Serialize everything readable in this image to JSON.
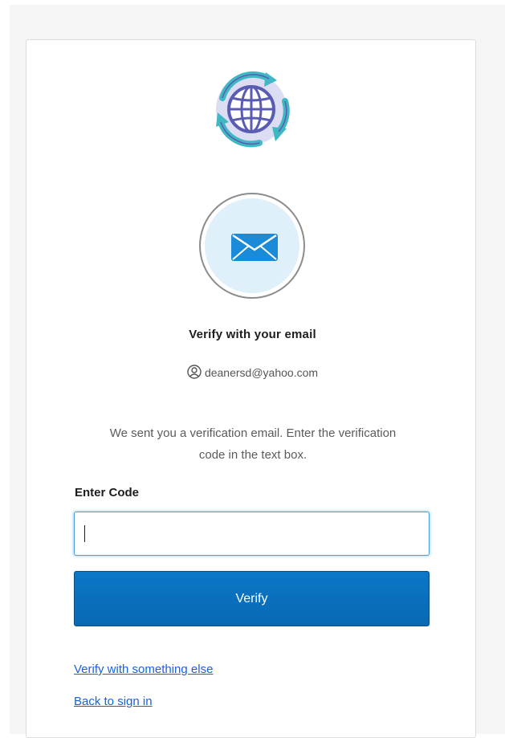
{
  "logo": {
    "icon": "globe-refresh-icon"
  },
  "auth_icon": {
    "icon": "email-envelope-icon"
  },
  "title": "Verify with your email",
  "identifier": {
    "icon": "user-circle-icon",
    "email": "deanersd@yahoo.com"
  },
  "instructions": "We sent you a verification email. Enter the verification code in the text box.",
  "code_field": {
    "label": "Enter Code",
    "value": "",
    "placeholder": ""
  },
  "verify_button": {
    "label": "Verify"
  },
  "links": {
    "verify_else": "Verify with something else",
    "back_to_sign_in": "Back to sign in"
  },
  "colors": {
    "primary_button": "#0a72c0",
    "link": "#1662dd",
    "icon_bg": "#dff0fb",
    "logo_purple": "#5a5cb4",
    "logo_teal": "#3fb8c3"
  }
}
